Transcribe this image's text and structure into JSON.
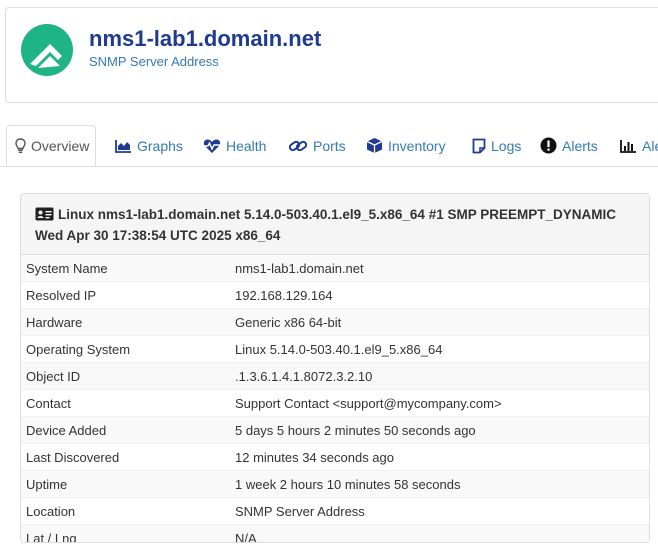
{
  "device": {
    "hostname": "nms1-lab1.domain.net",
    "subtitle": "SNMP Server Address",
    "brand_color": "#1fb486",
    "title_color": "#1f3a93",
    "link_color": "#337ab7"
  },
  "tabs": [
    {
      "label": "Overview",
      "icon": "lightbulb-icon",
      "active": true
    },
    {
      "label": "Graphs",
      "icon": "area-chart-icon",
      "active": false
    },
    {
      "label": "Health",
      "icon": "heartbeat-icon",
      "active": false
    },
    {
      "label": "Ports",
      "icon": "link-icon",
      "active": false
    },
    {
      "label": "Inventory",
      "icon": "cube-icon",
      "active": false
    },
    {
      "label": "Logs",
      "icon": "sticky-note-icon",
      "active": false
    },
    {
      "label": "Alerts",
      "icon": "exclamation-circle-icon",
      "active": false
    },
    {
      "label": "Ale",
      "icon": "bar-chart-icon",
      "active": false
    }
  ],
  "overview": {
    "heading": "Linux nms1-lab1.domain.net 5.14.0-503.40.1.el9_5.x86_64 #1 SMP PREEMPT_DYNAMIC Wed Apr 30 17:38:54 UTC 2025 x86_64",
    "heading_icon": "id-card-icon",
    "rows": [
      {
        "key": "System Name",
        "value": "nms1-lab1.domain.net"
      },
      {
        "key": "Resolved IP",
        "value": "192.168.129.164"
      },
      {
        "key": "Hardware",
        "value": "Generic x86 64-bit"
      },
      {
        "key": "Operating System",
        "value": "Linux 5.14.0-503.40.1.el9_5.x86_64"
      },
      {
        "key": "Object ID",
        "value": ".1.3.6.1.4.1.8072.3.2.10"
      },
      {
        "key": "Contact",
        "value": "Support Contact <support@mycompany.com>"
      },
      {
        "key": "Device Added",
        "value": "5 days 5 hours 2 minutes 50 seconds ago"
      },
      {
        "key": "Last Discovered",
        "value": "12 minutes 34 seconds ago"
      },
      {
        "key": "Uptime",
        "value": "1 week 2 hours 10 minutes 58 seconds"
      },
      {
        "key": "Location",
        "value": "SNMP Server Address"
      },
      {
        "key": "Lat / Lng",
        "value": "N/A"
      }
    ]
  }
}
